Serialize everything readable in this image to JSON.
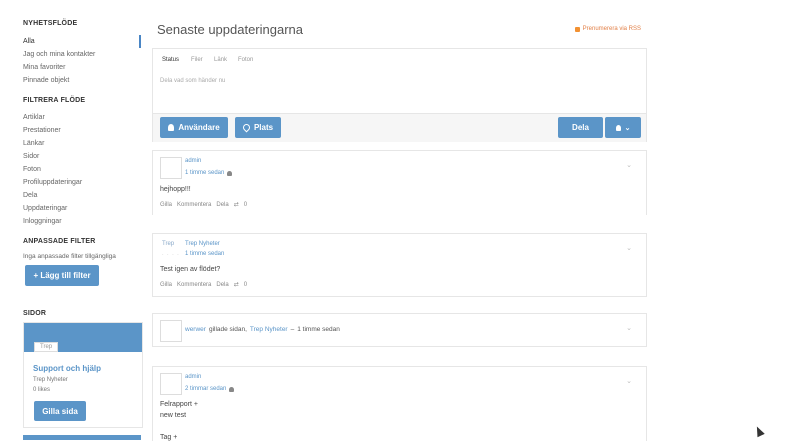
{
  "sidebar": {
    "newsfeed_title": "NYHETSFLÖDE",
    "newsfeed_items": [
      "Alla",
      "Jag och mina kontakter",
      "Mina favoriter",
      "Pinnade objekt"
    ],
    "filter_title": "FILTRERA FLÖDE",
    "filter_items": [
      "Artiklar",
      "Prestationer",
      "Länkar",
      "Sidor",
      "Foton",
      "Profiluppdateringar",
      "Dela",
      "Uppdateringar",
      "Inloggningar"
    ],
    "custom_title": "ANPASSADE FILTER",
    "custom_empty": "Inga anpassade filter tillgängliga",
    "add_filter_label": "+ Lägg till filter",
    "pages_title": "SIDOR",
    "page_card": {
      "tag": "Trep",
      "name": "Support och hjälp",
      "subtitle": "Trep Nyheter",
      "likes": "0 likes",
      "like_button": "Gilla sida"
    }
  },
  "main": {
    "title": "Senaste uppdateringarna",
    "rss_label": "Prenumerera via RSS",
    "composer": {
      "tabs": [
        "Status",
        "Filer",
        "Länk",
        "Foton"
      ],
      "placeholder": "Dela vad som händer nu",
      "users_button": "Användare",
      "place_button": "Plats",
      "share_button": "Dela"
    },
    "posts": [
      {
        "author": "admin",
        "time": "1 timme sedan",
        "text": "hejhopp!!!",
        "actions": [
          "Gilla",
          "Kommentera",
          "Dela"
        ],
        "share_count": "0"
      },
      {
        "avatar_text": "Trep",
        "author": "Trep Nyheter",
        "time": "1 timme sedan",
        "text": "Test igen av flödet?",
        "actions": [
          "Gilla",
          "Kommentera",
          "Dela"
        ],
        "share_count": "0"
      },
      {
        "actor": "werwer",
        "verb": "gillade sidan,",
        "target": "Trep Nyheter",
        "sep": "–",
        "time": "1 timme sedan"
      },
      {
        "author": "admin",
        "time": "2 timmar sedan",
        "lines": [
          "Felrapport +",
          "new test",
          "Tag +"
        ]
      }
    ]
  }
}
